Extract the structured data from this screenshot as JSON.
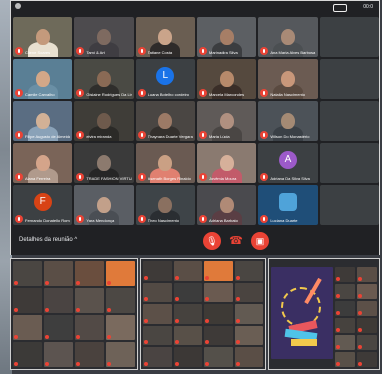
{
  "topbar": {
    "time": "00:0"
  },
  "participants": [
    {
      "name": "Cliene Soares",
      "type": "photo",
      "bg": "#6e6a5a",
      "skin": "#c49a7c",
      "shirt": "#e8e0d0"
    },
    {
      "name": "Tamí & Art",
      "type": "photo",
      "bg": "#4d4b4e",
      "skin": "#7e6a60",
      "shirt": "#3f3d42"
    },
    {
      "name": "Tatiane Costa",
      "type": "photo",
      "bg": "#6a5e52",
      "skin": "#caa48a",
      "shirt": "#2e2b2a"
    },
    {
      "name": "Marinadira Silva",
      "type": "photo",
      "bg": "#5c5f63",
      "skin": "#a67e66",
      "shirt": "#3b3d40"
    },
    {
      "name": "Ana Maria Alves Barbosa Cordeiro",
      "type": "photo",
      "bg": "#55585c",
      "skin": "#a88a76",
      "shirt": "#4b4f52"
    },
    {
      "name": "",
      "type": "blank",
      "bg": "#3c4043"
    },
    {
      "name": "Camile Carvalho",
      "type": "photo",
      "bg": "#5a7f95",
      "skin": "#d2a788",
      "shirt": "#6a8fa5"
    },
    {
      "name": "Gislaine Rodrigues Da Lima",
      "type": "photo",
      "bg": "#4a4a44",
      "skin": "#8a6a55",
      "shirt": "#2f2e2c"
    },
    {
      "name": "Luana Botelho cordeiro",
      "type": "avatar",
      "letter": "L",
      "color": "#1a73e8"
    },
    {
      "name": "Marcela Marcondes",
      "type": "photo",
      "bg": "#55493e",
      "skin": "#b78a6b",
      "shirt": "#3a2e28"
    },
    {
      "name": "Natalia Nascimento",
      "type": "photo",
      "bg": "#6b5b52",
      "skin": "#c8977a",
      "shirt": "#5a4a40"
    },
    {
      "name": "",
      "type": "blank",
      "bg": "#3c4043"
    },
    {
      "name": "Filipe Augusto de Almeida",
      "type": "photo",
      "bg": "#5a6d82",
      "skin": "#d2b196",
      "shirt": "#8aa2b8"
    },
    {
      "name": "elvira miranda",
      "type": "photo",
      "bg": "#3f3d38",
      "skin": "#6e5a4c",
      "shirt": "#2b2a27"
    },
    {
      "name": "Thaynara Duarte Vergara",
      "type": "photo",
      "bg": "#4a4643",
      "skin": "#9c7a66",
      "shirt": "#34302d"
    },
    {
      "name": "Maria Lúcia",
      "type": "photo",
      "bg": "#5f5a58",
      "skin": "#b09080",
      "shirt": "#4a4644"
    },
    {
      "name": "Wilson Do Monastério",
      "type": "photo",
      "bg": "#4c5258",
      "skin": "#a48a74",
      "shirt": "#3a4046"
    },
    {
      "name": "",
      "type": "blank",
      "bg": "#3c4043"
    },
    {
      "name": "Alana Ferreira",
      "type": "photo",
      "bg": "#7a6458",
      "skin": "#d4a48a",
      "shirt": "#b09a8c"
    },
    {
      "name": "TRADE FASHION VIRTUAL",
      "type": "photo",
      "bg": "#3a3a3a",
      "skin": "#8c7a6e",
      "shirt": "#262626"
    },
    {
      "name": "Asenath Borges Rinaldo",
      "type": "photo",
      "bg": "#6a5a52",
      "skin": "#caa084",
      "shirt": "#e08070"
    },
    {
      "name": "Jovêmia Moura",
      "type": "photo",
      "bg": "#8a7a70",
      "skin": "#d6b09a",
      "shirt": "#c25b6a"
    },
    {
      "name": "Adriana Da Silva Silva",
      "type": "avatar",
      "letter": "A",
      "color": "#9c5ac9"
    },
    {
      "name": "",
      "type": "blank",
      "bg": "#3c4043"
    },
    {
      "name": "Fernando Donatello Roman",
      "type": "avatar",
      "letter": "F",
      "color": "#d84315"
    },
    {
      "name": "Yara Mendonça",
      "type": "photo",
      "bg": "#5a5e64",
      "skin": "#c2a08a",
      "shirt": "#4a4e54"
    },
    {
      "name": "Theo Nascimento",
      "type": "photo",
      "bg": "#3e4448",
      "skin": "#8a7060",
      "shirt": "#2a2e32"
    },
    {
      "name": "Adriana Barbato",
      "type": "photo",
      "bg": "#4a4a4e",
      "skin": "#b08a76",
      "shirt": "#5a3e44"
    },
    {
      "name": "Luciana Duarte",
      "type": "logo",
      "bg": "#1f4e78",
      "color": "#4fa3d9"
    },
    {
      "name": "",
      "type": "blank",
      "bg": "#3c4043"
    }
  ],
  "bottombar": {
    "details": "Detalhes da reunião",
    "chevron": "^"
  },
  "colors": {
    "mic_off": "#ea4335",
    "bg": "#202124"
  },
  "sub1_tiles": [
    "#4a4642",
    "#5a4e46",
    "#6a4e3e",
    "#e07a3a",
    "#3e3a38",
    "#4a4442",
    "#5a524c",
    "#4c4844",
    "#6a5c52",
    "#3e3e3e",
    "#524a46",
    "#7a6a5e",
    "#3c3a38",
    "#5c5450",
    "#4a423e",
    "#6e6258"
  ],
  "sub2_tiles": [
    "#3e3a38",
    "#5a4e46",
    "#e07a3a",
    "#4a4642",
    "#524a44",
    "#3c3c3c",
    "#6a5a50",
    "#4a4440",
    "#5c5048",
    "#46423e",
    "#3e3a36",
    "#625a52",
    "#4a4642",
    "#585048",
    "#3e3a38",
    "#6a5e54",
    "#4a4442",
    "#3c3836",
    "#54504a",
    "#5a4e46"
  ],
  "sub3_tiles": [
    "#3e3a38",
    "#5a4e46",
    "#4a4642",
    "#6a5a50",
    "#3c3c3c",
    "#5c5048",
    "#46423e",
    "#3e3a36",
    "#625a52",
    "#4a4642",
    "#585048",
    "#3e3a38"
  ]
}
